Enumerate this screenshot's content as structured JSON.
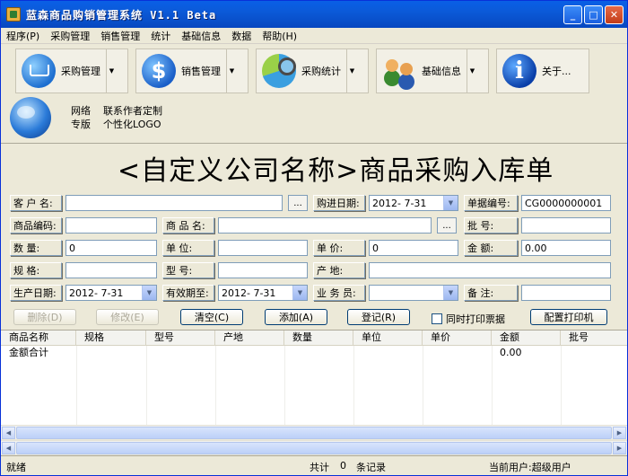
{
  "window": {
    "title": "蓝森商品购销管理系统 V1.1 Beta",
    "min": "_",
    "max": "□",
    "close": "✕"
  },
  "menu": [
    "程序(P)",
    "采购管理",
    "销售管理",
    "统计",
    "基础信息",
    "数据",
    "帮助(H)"
  ],
  "toolbar": {
    "purchase": "采购管理",
    "sales": "销售管理",
    "stats": "采购统计",
    "basic": "基础信息",
    "about": "关于...",
    "net_line1_a": "网络",
    "net_line1_b": "联系作者定制",
    "net_line2_a": "专版",
    "net_line2_b": "个性化LOGO",
    "dollar": "$",
    "info": "i",
    "drop": "▼"
  },
  "form": {
    "heading": "<自定义公司名称>商品采购入库单",
    "customer_label": "客 户 名:",
    "ellipsis": "...",
    "purchase_date_label": "购进日期:",
    "purchase_date": "2012- 7-31",
    "doc_no_label": "单据编号:",
    "doc_no": "CG0000000001",
    "code_label": "商品编码:",
    "name_label": "商 品 名:",
    "batch_label": "批    号:",
    "qty_label": "数    量:",
    "qty": "0",
    "unit_label": "单    位:",
    "price_label": "单    价:",
    "price": "0",
    "amount_label": "金    额:",
    "amount": "0.00",
    "spec_label": "规    格:",
    "model_label": "型    号:",
    "origin_label": "产    地:",
    "mfg_label": "生产日期:",
    "mfg_date": "2012- 7-31",
    "exp_label": "有效期至:",
    "exp_date": "2012- 7-31",
    "clerk_label": "业 务 员:",
    "note_label": "备    注:"
  },
  "buttons": {
    "delete": "删除(D)",
    "edit": "修改(E)",
    "clear": "清空(C)",
    "add": "添加(A)",
    "register": "登记(R)",
    "print_ticket": "同时打印票据",
    "printer": "配置打印机"
  },
  "table": {
    "columns": [
      "商品名称",
      "规格",
      "型号",
      "产地",
      "数量",
      "单位",
      "单价",
      "金额",
      "批号"
    ],
    "total_label": "金额合计",
    "total_amount": "0.00"
  },
  "status": {
    "ready": "就绪",
    "count_label": "共计",
    "count": "0",
    "count_unit": "条记录",
    "user": "当前用户:超级用户"
  },
  "scroll": {
    "left": "◀",
    "right": "▶"
  }
}
